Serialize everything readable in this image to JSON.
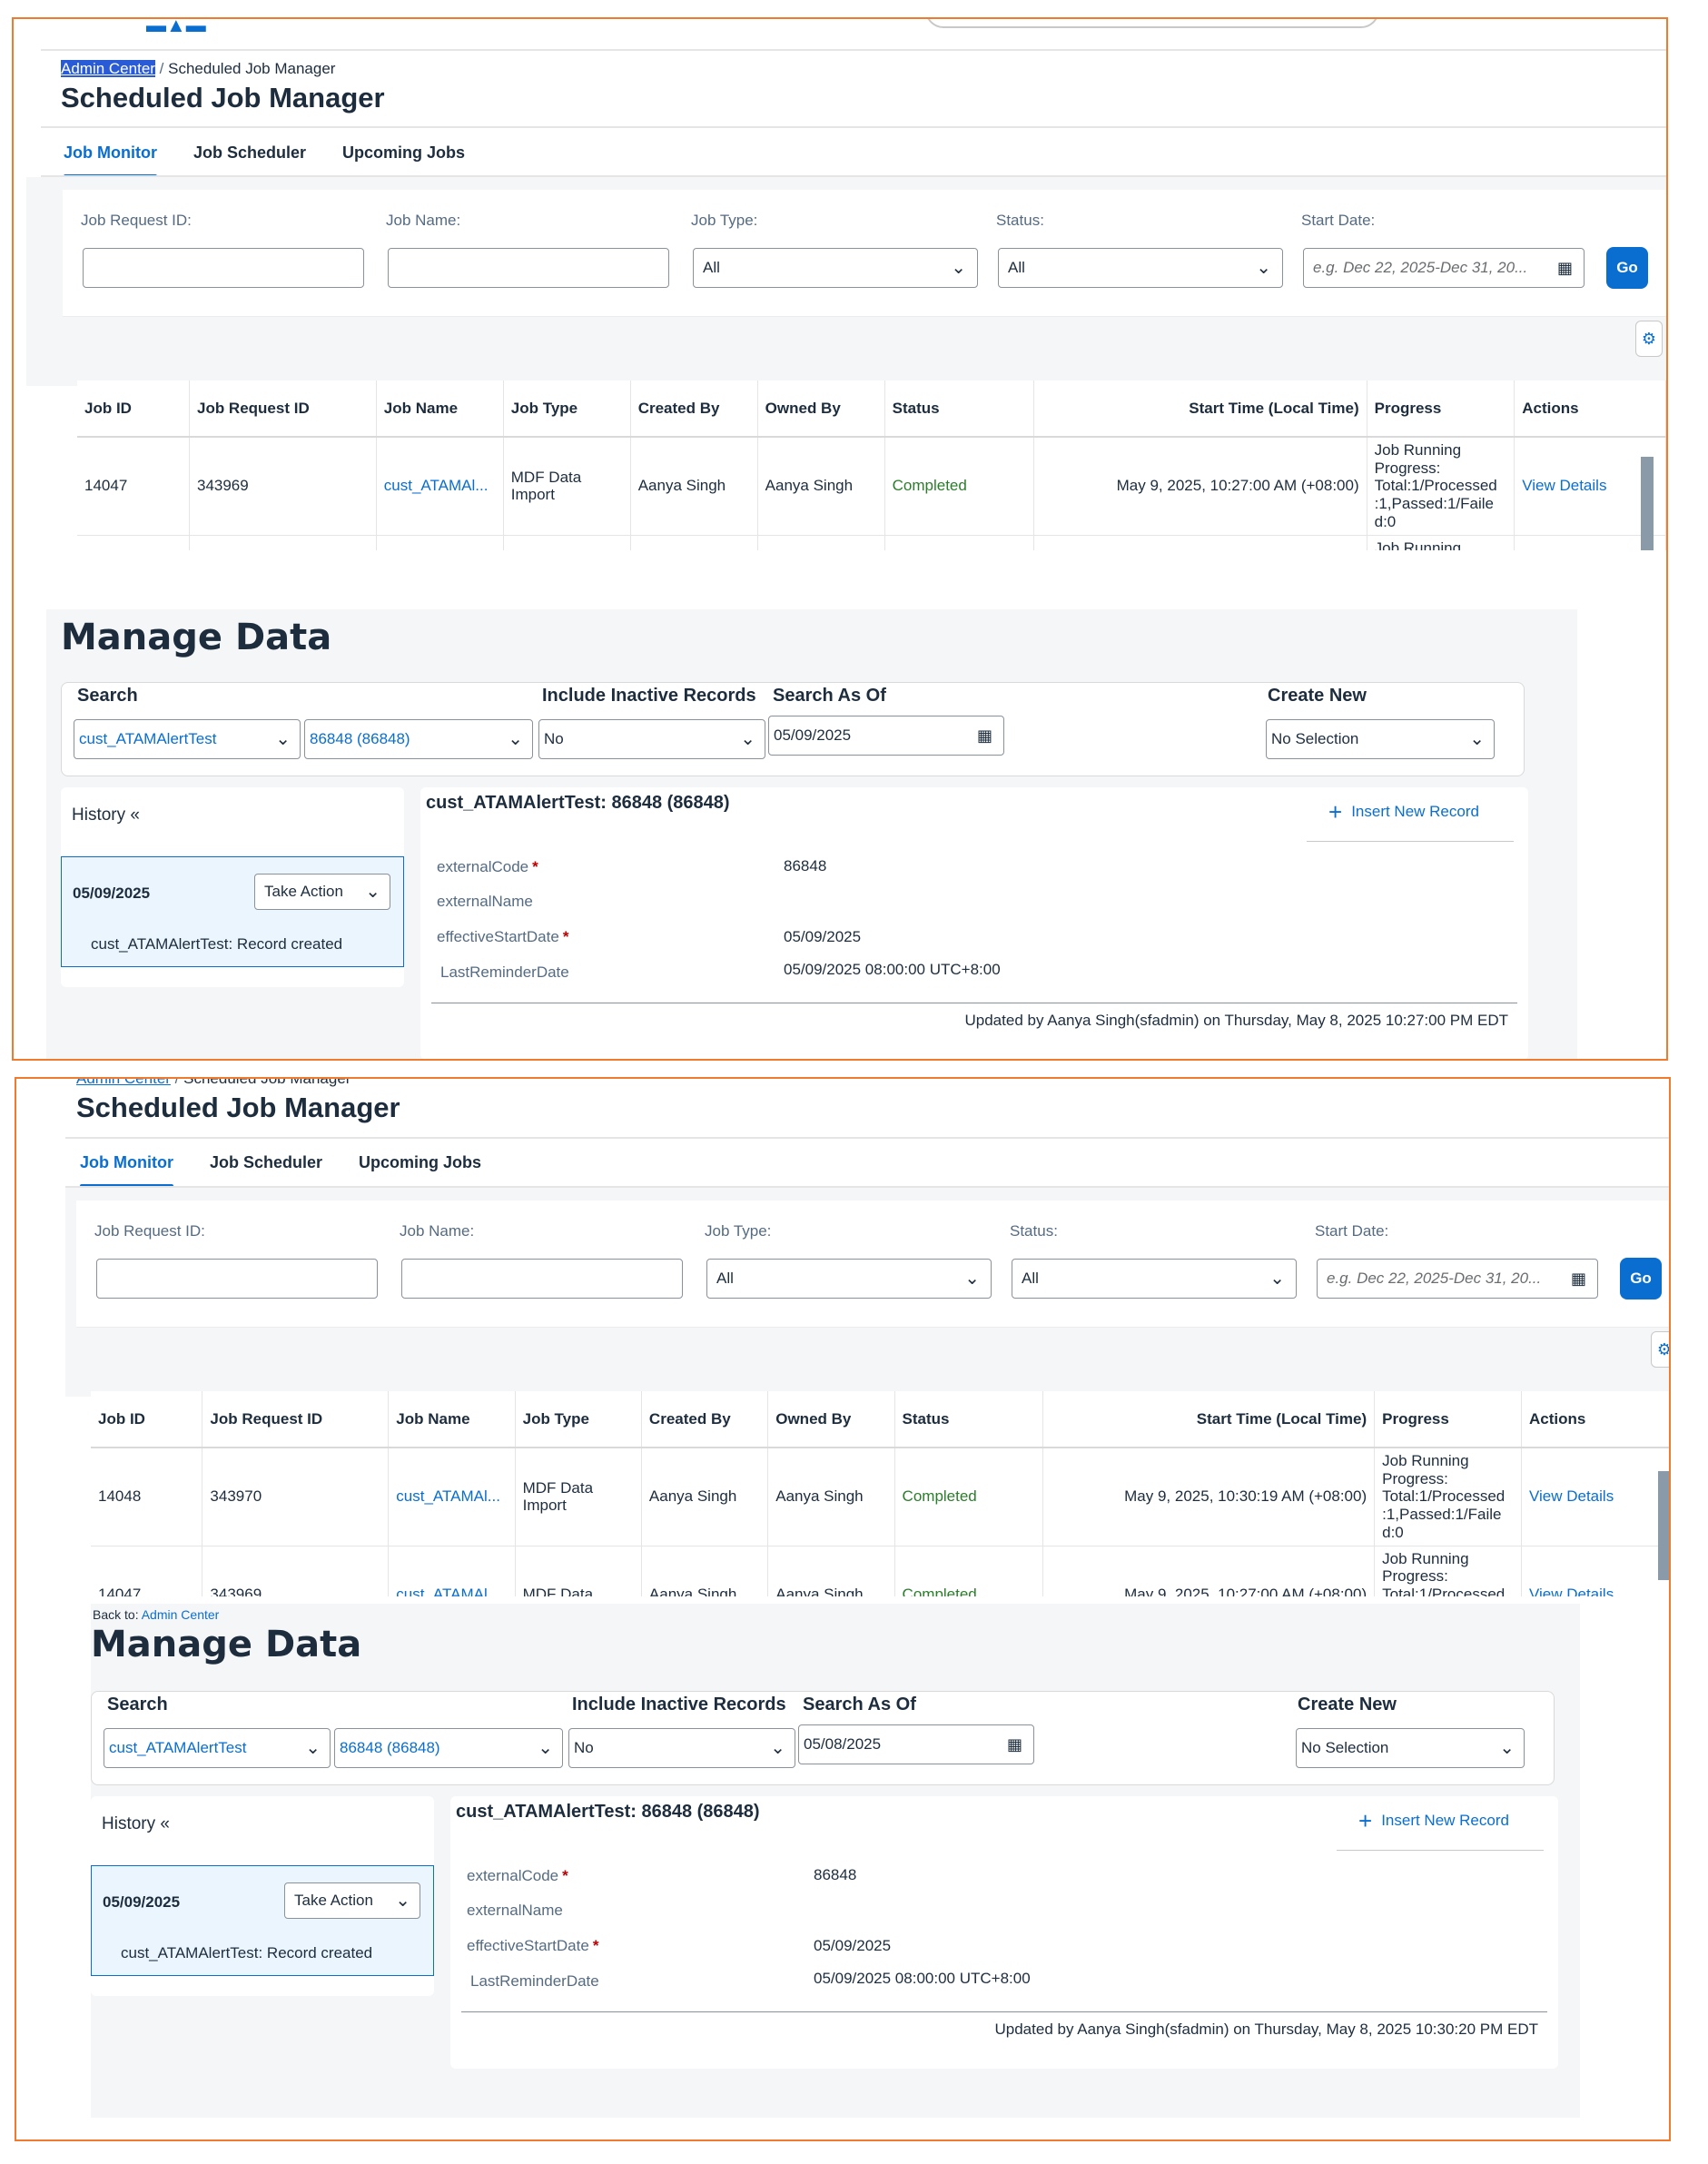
{
  "shots": [
    {
      "job": {
        "breadcrumb": {
          "link": "Admin Center",
          "sep": "/",
          "current": "Scheduled Job Manager"
        },
        "title": "Scheduled Job Manager",
        "tabs": [
          "Job Monitor",
          "Job Scheduler",
          "Upcoming Jobs"
        ],
        "filters": {
          "job_request_id_label": "Job Request ID:",
          "job_name_label": "Job Name:",
          "job_type_label": "Job Type:",
          "job_type_value": "All",
          "status_label": "Status:",
          "status_value": "All",
          "start_date_label": "Start Date:",
          "start_date_placeholder": "e.g. Dec 22, 2025-Dec 31, 20...",
          "go_label": "Go"
        },
        "columns": [
          "Job ID",
          "Job Request ID",
          "Job Name",
          "Job Type",
          "Created By",
          "Owned By",
          "Status",
          "Start Time (Local Time)",
          "Progress",
          "Actions"
        ],
        "rows": [
          {
            "job_id": "14047",
            "request_id": "343969",
            "name": "cust_ATAMAl...",
            "type": "MDF Data Import",
            "created_by": "Aanya Singh",
            "owned_by": "Aanya Singh",
            "status": "Completed",
            "start": "May 9, 2025, 10:27:00 AM (+08:00)",
            "progress": "Job Running Progress: Total:1/Processed :1,Passed:1/Faile d:0",
            "action": "View Details"
          },
          {
            "progress": "Job Running"
          }
        ]
      },
      "manage": {
        "back_prefix": "",
        "back_link": "",
        "title": "Manage Data",
        "search_label": "Search",
        "object_select": "cust_ATAMAlertTest",
        "record_select": "86848 (86848)",
        "inactive_label": "Include Inactive Records",
        "inactive_value": "No",
        "as_of_label": "Search As Of",
        "as_of_value": "05/09/2025",
        "create_label": "Create New",
        "create_value": "No Selection",
        "history_title": "History «",
        "history_date": "05/09/2025",
        "take_action": "Take Action",
        "history_note": "cust_ATAMAlertTest: Record created",
        "record_title": "cust_ATAMAlertTest: 86848 (86848)",
        "insert_label": "Insert New Record",
        "fields": [
          {
            "label": "externalCode",
            "value": "86848"
          },
          {
            "label": "externalName",
            "value": ""
          },
          {
            "label": "effectiveStartDate",
            "value": "05/09/2025"
          },
          {
            "label": "LastReminderDate",
            "value": "05/09/2025 08:00:00 UTC+8:00"
          }
        ],
        "updated": "Updated by Aanya Singh(sfadmin) on Thursday, May 8, 2025 10:27:00 PM EDT"
      }
    },
    {
      "job": {
        "breadcrumb": {
          "link": "Admin Center",
          "sep": "/",
          "current": "Scheduled Job Manager"
        },
        "title": "Scheduled Job Manager",
        "tabs": [
          "Job Monitor",
          "Job Scheduler",
          "Upcoming Jobs"
        ],
        "filters": {
          "job_request_id_label": "Job Request ID:",
          "job_name_label": "Job Name:",
          "job_type_label": "Job Type:",
          "job_type_value": "All",
          "status_label": "Status:",
          "status_value": "All",
          "start_date_label": "Start Date:",
          "start_date_placeholder": "e.g. Dec 22, 2025-Dec 31, 20...",
          "go_label": "Go"
        },
        "columns": [
          "Job ID",
          "Job Request ID",
          "Job Name",
          "Job Type",
          "Created By",
          "Owned By",
          "Status",
          "Start Time (Local Time)",
          "Progress",
          "Actions"
        ],
        "rows": [
          {
            "job_id": "14048",
            "request_id": "343970",
            "name": "cust_ATAMAl...",
            "type": "MDF Data Import",
            "created_by": "Aanya Singh",
            "owned_by": "Aanya Singh",
            "status": "Completed",
            "start": "May 9, 2025, 10:30:19 AM (+08:00)",
            "progress": "Job Running Progress: Total:1/Processed :1,Passed:1/Faile d:0",
            "action": "View Details"
          },
          {
            "job_id": "14047",
            "request_id": "343969",
            "name": "cust_ATAMAl...",
            "type": "MDF Data",
            "created_by": "Aanya Singh",
            "owned_by": "Aanya Singh",
            "status": "Completed",
            "start": "May 9, 2025, 10:27:00 AM (+08:00)",
            "progress": "Job Running Progress: Total:1/Processed",
            "action": "View Details"
          }
        ]
      },
      "manage": {
        "back_prefix": "Back to:",
        "back_link": "Admin Center",
        "title": "Manage Data",
        "search_label": "Search",
        "object_select": "cust_ATAMAlertTest",
        "record_select": "86848 (86848)",
        "inactive_label": "Include Inactive Records",
        "inactive_value": "No",
        "as_of_label": "Search As Of",
        "as_of_value": "05/08/2025",
        "create_label": "Create New",
        "create_value": "No Selection",
        "history_title": "History «",
        "history_date": "05/09/2025",
        "take_action": "Take Action",
        "history_note": "cust_ATAMAlertTest: Record created",
        "record_title": "cust_ATAMAlertTest: 86848 (86848)",
        "insert_label": "Insert New Record",
        "fields": [
          {
            "label": "externalCode",
            "value": "86848"
          },
          {
            "label": "externalName",
            "value": ""
          },
          {
            "label": "effectiveStartDate",
            "value": "05/09/2025"
          },
          {
            "label": "LastReminderDate",
            "value": "05/09/2025 08:00:00 UTC+8:00"
          }
        ],
        "updated": "Updated by Aanya Singh(sfadmin) on Thursday, May 8, 2025 10:30:20 PM EDT"
      }
    }
  ]
}
